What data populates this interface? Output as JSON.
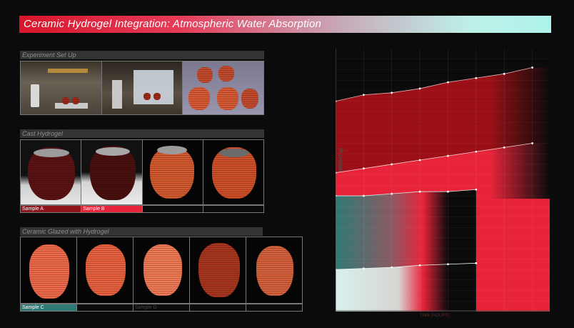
{
  "header": {
    "title": "Ceramic Hydrogel Integration: Atmospheric Water Absorption"
  },
  "panels": {
    "setup": {
      "label": "Experiment Set Up"
    },
    "cast": {
      "label": "Cast Hydrogel",
      "captions": [
        "Sample A",
        "Sample B",
        "",
        ""
      ]
    },
    "glazed": {
      "label": "Ceramic Glazed with Hydrogel",
      "captions": [
        "Sample C",
        "",
        "Sample D",
        "",
        ""
      ]
    }
  },
  "chart": {
    "ylabel": "WEIGHT (g)",
    "xlabel": "TIME (HOURS)"
  },
  "colors": {
    "dark_red": "#9a1016",
    "red": "#e8243a",
    "teal": "#2f7a75",
    "pale_teal": "#c9ece6",
    "background": "#0b0b0b"
  },
  "chart_data": {
    "type": "area",
    "title": "",
    "xlabel": "TIME (HOURS)",
    "ylabel": "WEIGHT (g)",
    "x": [
      0,
      1,
      2,
      3,
      4,
      5,
      6,
      7
    ],
    "series": [
      {
        "values": [
          100,
          103,
          104,
          106,
          109,
          111,
          113,
          116
        ]
      },
      {
        "values": [
          66,
          68,
          70,
          72,
          74,
          76,
          78,
          80
        ]
      },
      {
        "values": [
          55,
          55,
          56,
          57,
          57,
          58
        ]
      },
      {
        "values": [
          20,
          20.5,
          21,
          22,
          22.5,
          23
        ]
      }
    ],
    "grid": true
  }
}
